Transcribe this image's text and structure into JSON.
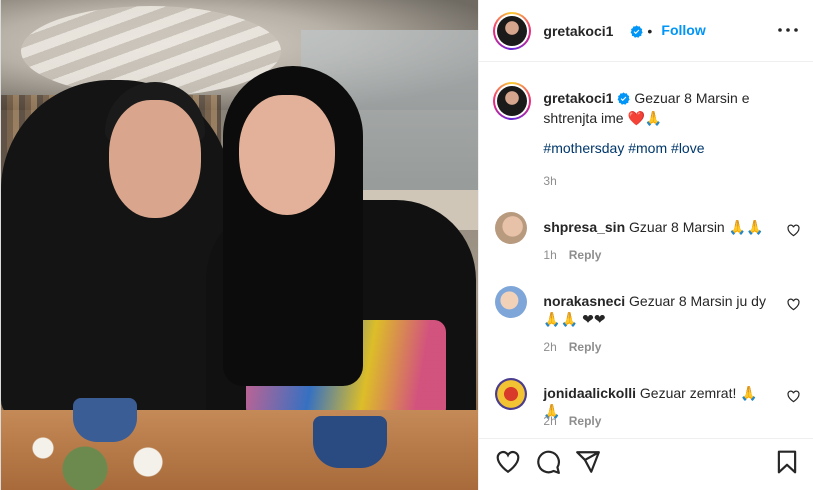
{
  "post": {
    "author": {
      "username": "gretakoci1",
      "verified_icon": "verified-badge-icon",
      "follow_label": "Follow",
      "separator": "•"
    },
    "caption": {
      "username": "gretakoci1",
      "text": "Gezuar 8 Marsin e shtrenjta ime ❤️🙏",
      "hashtags": [
        "#mothersday",
        "#mom",
        "#love"
      ],
      "time": "3h"
    },
    "comments": [
      {
        "username": "shpresa_sin",
        "text": "Gzuar 8 Marsin 🙏🙏",
        "time": "1h",
        "reply_label": "Reply"
      },
      {
        "username": "norakasneci",
        "text": "Gezuar 8 Marsin ju dy 🙏🙏 ❤❤",
        "time": "2h",
        "reply_label": "Reply"
      },
      {
        "username": "jonidaalickolli",
        "text": "Gezuar zemrat! 🙏🙏",
        "time": "2h",
        "reply_label": "Reply"
      }
    ],
    "action_icons": [
      "heart-icon",
      "comment-icon",
      "share-icon",
      "bookmark-icon"
    ],
    "colors": {
      "link": "#0095f6",
      "hashtag": "#00376b",
      "muted": "#8e8e8e",
      "text": "#262626"
    }
  }
}
